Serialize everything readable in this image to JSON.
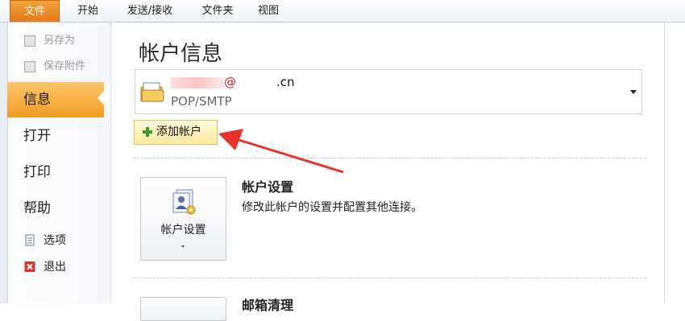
{
  "ribbon": {
    "tabs": [
      "文件",
      "开始",
      "发送/接收",
      "文件夹",
      "视图"
    ]
  },
  "backstage": {
    "commands_top": [
      {
        "label": "另存为",
        "icon": "save-as-icon"
      },
      {
        "label": "保存附件",
        "icon": "save-attachments-icon"
      }
    ],
    "nav": [
      {
        "label": "信息",
        "active": true
      },
      {
        "label": "打开",
        "active": false
      },
      {
        "label": "打印",
        "active": false
      },
      {
        "label": "帮助",
        "active": false
      }
    ],
    "commands_bottom": [
      {
        "label": "选项",
        "icon": "options-icon"
      },
      {
        "label": "退出",
        "icon": "exit-icon",
        "icon_color": "#d9342b"
      }
    ]
  },
  "main": {
    "title": "帐户信息",
    "account": {
      "email_suffix": ".cn",
      "email_at": "@",
      "type": "POP/SMTP"
    },
    "add_account_label": "添加帐户",
    "add_account_icon_color": "#3a9a2e",
    "account_settings": {
      "button_label": "帐户设置",
      "title": "帐户设置",
      "description": "修改此帐户的设置并配置其他连接。"
    },
    "mailbox_cleanup": {
      "title_partial": "邮箱清理"
    }
  },
  "colors": {
    "file_tab": "#e6781a",
    "active_nav": "#f49b25",
    "annotation_arrow": "#e8322c"
  }
}
